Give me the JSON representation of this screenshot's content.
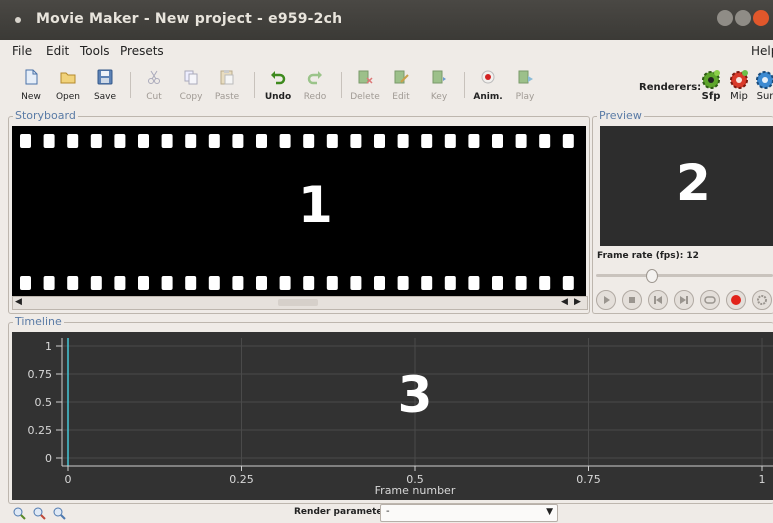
{
  "window": {
    "title": "Movie Maker - New project - e959-2ch"
  },
  "menu": {
    "file": "File",
    "edit": "Edit",
    "tools": "Tools",
    "presets": "Presets",
    "help": "Help"
  },
  "toolbar": {
    "new": "New",
    "open": "Open",
    "save": "Save",
    "cut": "Cut",
    "copy": "Copy",
    "paste": "Paste",
    "undo": "Undo",
    "redo": "Redo",
    "delete": "Delete",
    "edit": "Edit",
    "key": "Key",
    "anim": "Anim.",
    "play": "Play"
  },
  "renderers": {
    "label": "Renderers:",
    "sfp": "Sfp",
    "mip": "Mip",
    "sur": "Sur"
  },
  "storyboard": {
    "label": "Storyboard",
    "marker": "1"
  },
  "preview": {
    "label": "Preview",
    "marker": "2",
    "frame_rate_label": "Frame rate (fps): 12",
    "frame_rate": 12
  },
  "timeline": {
    "label": "Timeline",
    "marker": "3",
    "xlabel": "Frame number",
    "y_ticks": [
      "1",
      "0.75",
      "0.5",
      "0.25",
      "0"
    ],
    "x_ticks": [
      "0",
      "0.25",
      "0.5",
      "0.75",
      "1"
    ]
  },
  "statusbar": {
    "render_parameter_label": "Render parameter",
    "render_parameter_value": "-"
  },
  "colors": {
    "accent": "#5a7ba6",
    "titlebar": "#3c3b37",
    "close": "#e0572b",
    "timeline_bg": "#323232",
    "cursor": "#46c7d8"
  }
}
